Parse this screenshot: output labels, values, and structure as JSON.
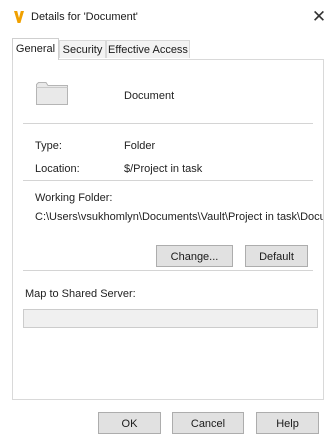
{
  "window": {
    "title": "Details for 'Document'",
    "close_glyph": "✕",
    "app_icon": "vault-v-icon",
    "app_icon_color": "#f0a000"
  },
  "tabs": [
    {
      "label": "General",
      "active": true
    },
    {
      "label": "Security",
      "active": false
    },
    {
      "label": "Effective Access",
      "active": false
    }
  ],
  "general": {
    "folder_icon": "folder-icon",
    "name": "Document",
    "type_label": "Type:",
    "type_value": "Folder",
    "location_label": "Location:",
    "location_value": "$/Project in task",
    "working_folder_label": "Working Folder:",
    "working_folder_value": "C:\\Users\\vsukhomlyn\\Documents\\Vault\\Project in task\\Document",
    "change_button": "Change...",
    "default_button": "Default",
    "map_label": "Map to Shared Server:",
    "map_value": ""
  },
  "footer": {
    "ok": "OK",
    "cancel": "Cancel",
    "help": "Help"
  }
}
